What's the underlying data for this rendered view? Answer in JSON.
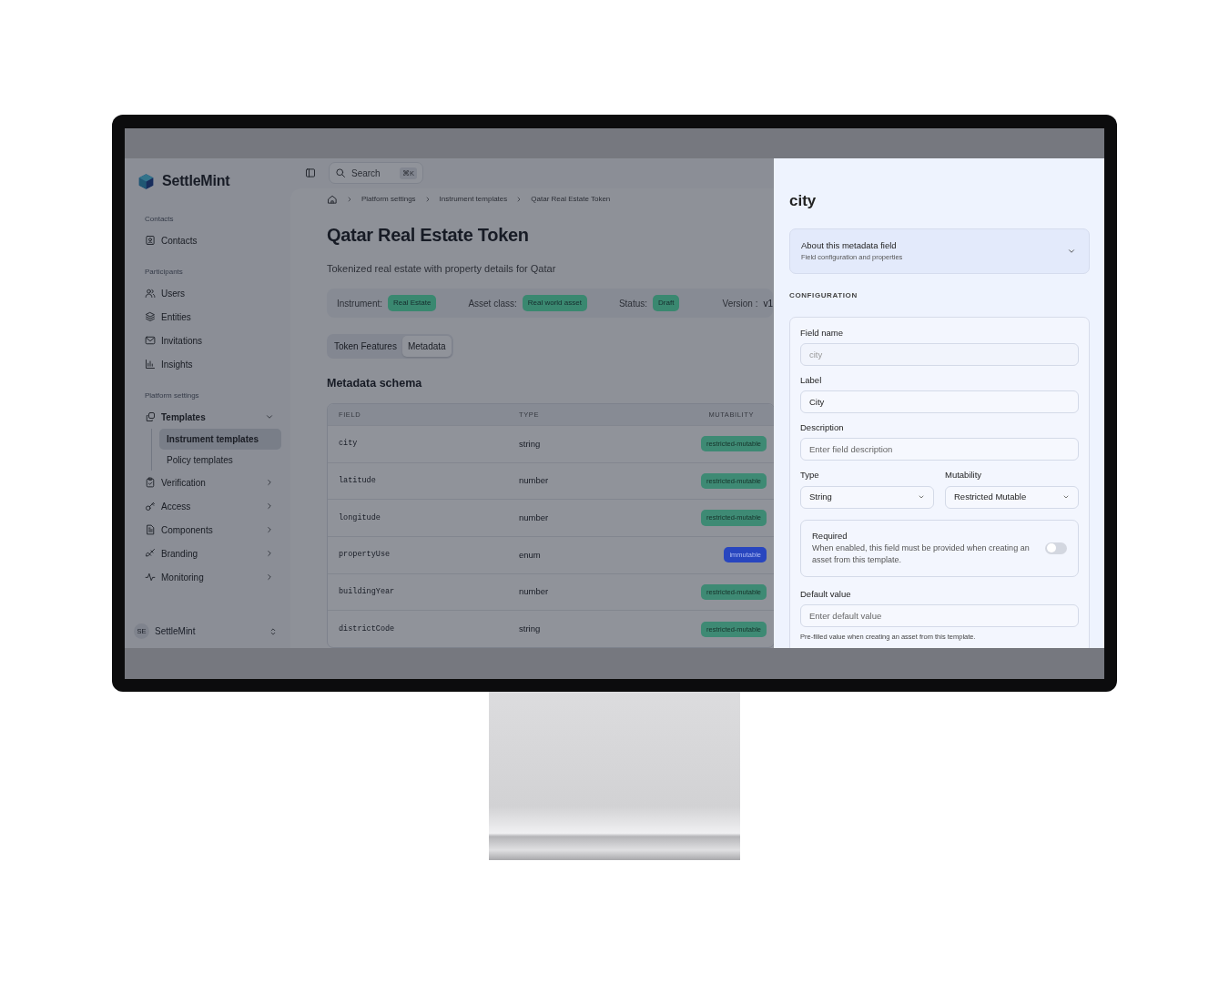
{
  "sidebar": {
    "brand": "SettleMint",
    "sections": [
      {
        "heading": "Contacts",
        "items": [
          {
            "label": "Contacts",
            "selected": false
          }
        ]
      },
      {
        "heading": "Participants",
        "items": [
          {
            "label": "Users",
            "selected": false
          },
          {
            "label": "Entities",
            "selected": false
          },
          {
            "label": "Invitations",
            "selected": false
          },
          {
            "label": "Insights",
            "selected": false
          }
        ]
      },
      {
        "heading": "Platform settings",
        "items": [
          {
            "label": "Templates",
            "selected": false,
            "expanded": true,
            "children": [
              {
                "label": "Instrument templates",
                "selected": true
              },
              {
                "label": "Policy templates",
                "selected": false
              }
            ]
          },
          {
            "label": "Verification",
            "selected": false,
            "expanded": false
          },
          {
            "label": "Access",
            "selected": false,
            "expanded": false
          },
          {
            "label": "Components",
            "selected": false,
            "expanded": false
          },
          {
            "label": "Branding",
            "selected": false,
            "expanded": false
          },
          {
            "label": "Monitoring",
            "selected": false,
            "expanded": false
          }
        ]
      }
    ],
    "org": {
      "initials": "SE",
      "name": "SettleMint"
    }
  },
  "header": {
    "search": {
      "placeholder": "Search",
      "shortcut": "⌘K"
    }
  },
  "breadcrumb": [
    "Platform settings",
    "Instrument templates",
    "Qatar Real Estate Token"
  ],
  "title": "Qatar Real Estate Token",
  "subtitle": "Tokenized real estate with property details for Qatar",
  "meta": [
    {
      "label": "Instrument:",
      "value": "Real Estate",
      "kind": "badge"
    },
    {
      "label": "Asset class:",
      "value": "Real world asset",
      "kind": "badge"
    },
    {
      "label": "Status:",
      "value": "Draft",
      "kind": "badge"
    },
    {
      "label": "Version :",
      "value": "v1",
      "kind": "text"
    }
  ],
  "tabs": [
    {
      "label": "Token Features",
      "selected": false
    },
    {
      "label": "Metadata",
      "selected": true
    }
  ],
  "section_title": "Metadata schema",
  "table": {
    "columns": [
      "FIELD",
      "TYPE",
      "MUTABILITY"
    ],
    "rows": [
      {
        "field": "city",
        "type": "string",
        "mutability": "restricted-mutable",
        "color": "#3e8a74"
      },
      {
        "field": "latitude",
        "type": "number",
        "mutability": "restricted-mutable",
        "color": "#3e8a74"
      },
      {
        "field": "longitude",
        "type": "number",
        "mutability": "restricted-mutable",
        "color": "#3e8a74"
      },
      {
        "field": "propertyUse",
        "type": "enum",
        "mutability": "immutable",
        "color": "#2846bf"
      },
      {
        "field": "buildingYear",
        "type": "number",
        "mutability": "restricted-mutable",
        "color": "#3e8a74"
      },
      {
        "field": "districtCode",
        "type": "string",
        "mutability": "restricted-mutable",
        "color": "#3e8a74"
      }
    ]
  },
  "panel": {
    "title": "city",
    "about": {
      "title": "About this metadata field",
      "subtitle": "Field configuration and properties",
      "expanded": false
    },
    "section": "CONFIGURATION",
    "fields": [
      {
        "kind": "input",
        "label": "Field name",
        "value": "city",
        "disabled": true
      },
      {
        "kind": "input",
        "label": "Label",
        "value": "City",
        "disabled": false
      },
      {
        "kind": "input",
        "label": "Description",
        "placeholder": "Enter field description"
      },
      {
        "kind": "selects",
        "items": [
          {
            "label": "Type",
            "value": "String"
          },
          {
            "label": "Mutability",
            "value": "Restricted Mutable"
          }
        ]
      },
      {
        "kind": "toggle",
        "label": "Required",
        "description": "When enabled, this field must be provided when creating an asset from this template.",
        "on": false
      },
      {
        "kind": "input",
        "label": "Default value",
        "placeholder": "Enter default value",
        "help": "Pre-filled value when creating an asset from this template."
      }
    ]
  }
}
